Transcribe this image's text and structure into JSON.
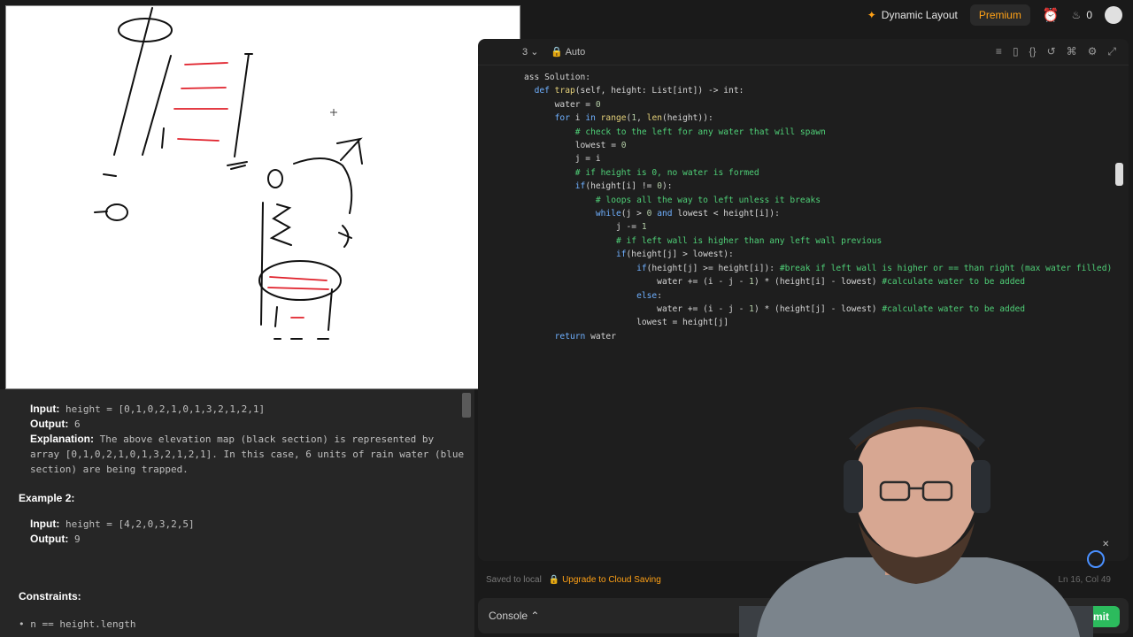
{
  "nav": {
    "dynamic_layout": "Dynamic Layout",
    "premium": "Premium",
    "streak_count": "0"
  },
  "editor": {
    "lang_fragment": "3",
    "mode": "Auto",
    "code_lines": [
      "ass Solution:",
      "  def trap(self, height: List[int]) -> int:",
      "      water = 0",
      "      for i in range(1, len(height)):",
      "          # check to the left for any water that will spawn",
      "          lowest = 0",
      "          j = i",
      "          # if height is 0, no water is formed",
      "          if(height[i] != 0):",
      "              # loops all the way to left unless it breaks",
      "              while(j > 0 and lowest < height[i]):",
      "                  j -= 1",
      "                  # if left wall is higher than any left wall previous",
      "                  if(height[j] > lowest):",
      "                      if(height[j] >= height[i]): #break if left wall is higher or == than right (max water filled)",
      "                          water += (i - j - 1) * (height[i] - lowest) #calculate water to be added",
      "                      else:",
      "                          water += (i - j - 1) * (height[j] - lowest) #calculate water to be added",
      "                      lowest = height[j]",
      "      return water"
    ]
  },
  "status": {
    "saved": "Saved to local",
    "upgrade": "Upgrade to Cloud Saving",
    "lncol": "Ln 16, Col 49"
  },
  "console": {
    "label": "Console",
    "submit": "Submit"
  },
  "description": {
    "ex1_input_label": "Input:",
    "ex1_input": "height = [0,1,0,2,1,0,1,3,2,1,2,1]",
    "ex1_output_label": "Output:",
    "ex1_output": "6",
    "ex1_expl_label": "Explanation:",
    "ex1_expl_line1": "The above elevation map (black section) is represented by",
    "ex1_expl_line2": "array [0,1,0,2,1,0,1,3,2,1,2,1]. In this case, 6 units of rain water (blue",
    "ex1_expl_line3": "section) are being trapped.",
    "ex2_title": "Example 2:",
    "ex2_input_label": "Input:",
    "ex2_input": "height = [4,2,0,3,2,5]",
    "ex2_output_label": "Output:",
    "ex2_output": "9",
    "constraints_title": "Constraints:",
    "constraint1": "n == height.length"
  },
  "icons": [
    "sparkle-icon",
    "alarm-icon",
    "flame-icon",
    "lock-icon",
    "chevron-down-icon",
    "chat-icon",
    "close-icon"
  ],
  "colors": {
    "accent": "#ffa116",
    "submit": "#2cbb5d",
    "comment": "#4fcf77",
    "keyword": "#6fb0ff"
  }
}
